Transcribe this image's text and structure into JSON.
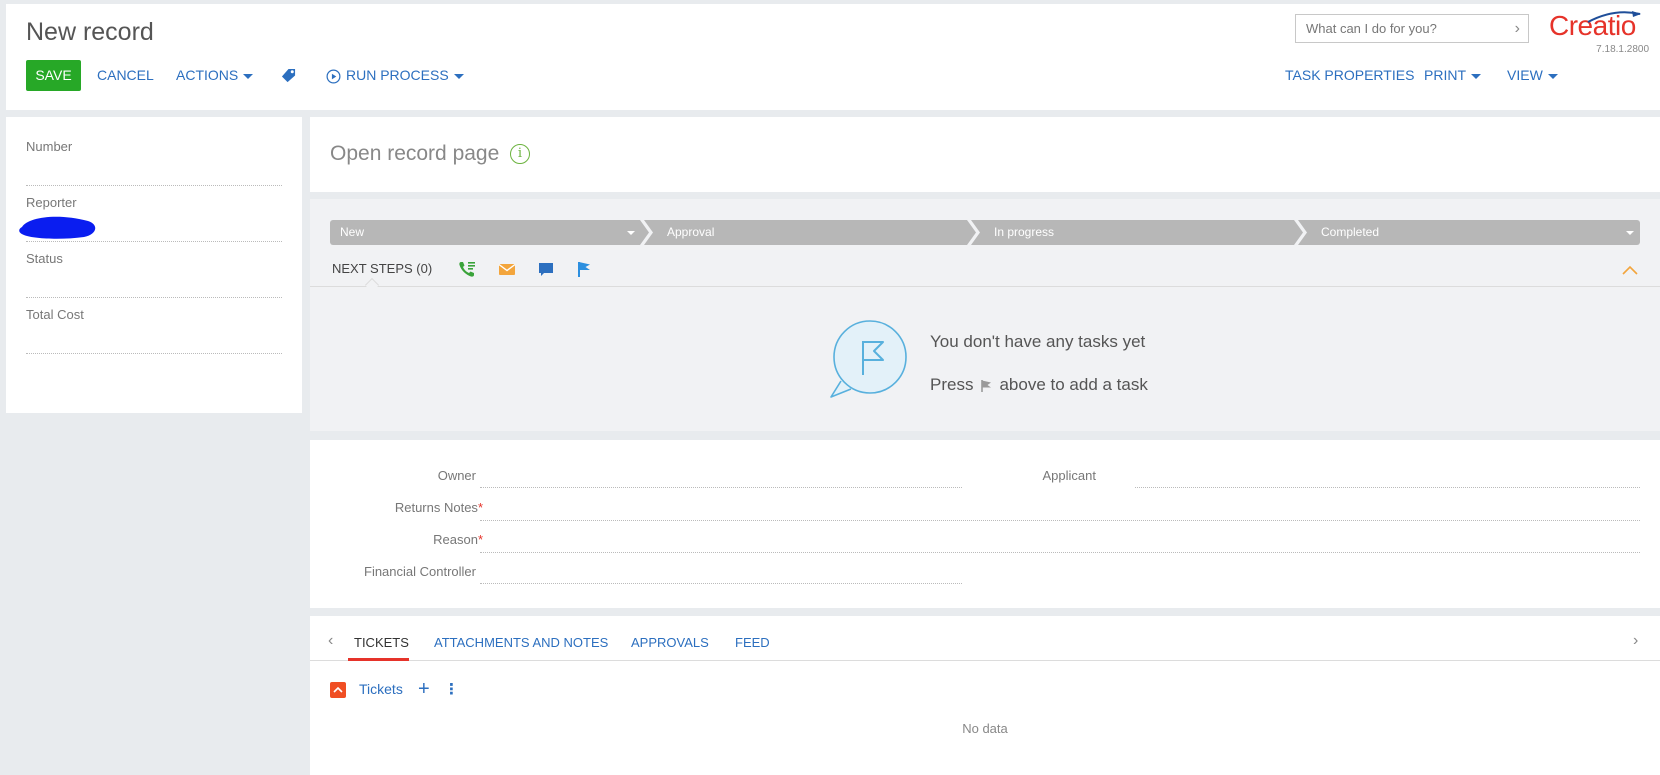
{
  "header": {
    "title": "New record",
    "search_placeholder": "What can I do for you?",
    "logo": "Creatio",
    "version": "7.18.1.2800",
    "toolbar": {
      "save": "SAVE",
      "cancel": "CANCEL",
      "actions": "ACTIONS",
      "run_process": "RUN PROCESS",
      "task_properties": "TASK PROPERTIES",
      "print": "PRINT",
      "view": "VIEW"
    }
  },
  "left_panel": {
    "fields": [
      {
        "label": "Number",
        "value": ""
      },
      {
        "label": "Reporter",
        "value": ""
      },
      {
        "label": "Status",
        "value": ""
      },
      {
        "label": "Total Cost",
        "value": ""
      }
    ]
  },
  "open_record": {
    "title": "Open record page",
    "info_icon_glyph": "i"
  },
  "stages": [
    {
      "label": "New"
    },
    {
      "label": "Approval"
    },
    {
      "label": "In progress"
    },
    {
      "label": "Completed"
    }
  ],
  "next_steps": {
    "label": "NEXT STEPS (0)",
    "icons": [
      "call-icon",
      "email-icon",
      "chat-icon",
      "flag-icon"
    ],
    "empty_line1": "You don't have any tasks yet",
    "empty_line2_before": "Press",
    "empty_line2_after": "above to add a task"
  },
  "fields": {
    "owner": "Owner",
    "applicant": "Applicant",
    "returns_notes": "Returns Notes",
    "reason": "Reason",
    "financial_controller": "Financial Controller",
    "required_marker": "*"
  },
  "tabs": {
    "items": [
      "TICKETS",
      "ATTACHMENTS AND NOTES",
      "APPROVALS",
      "FEED"
    ],
    "active": "TICKETS",
    "detail_title": "Tickets",
    "add_glyph": "+",
    "menu_glyph": "⋮",
    "no_data": "No data"
  },
  "colors": {
    "accent": "#2c6fbf",
    "save_green": "#27a827",
    "brand_red": "#e6332a",
    "stage_grey": "#b7b7b7"
  }
}
